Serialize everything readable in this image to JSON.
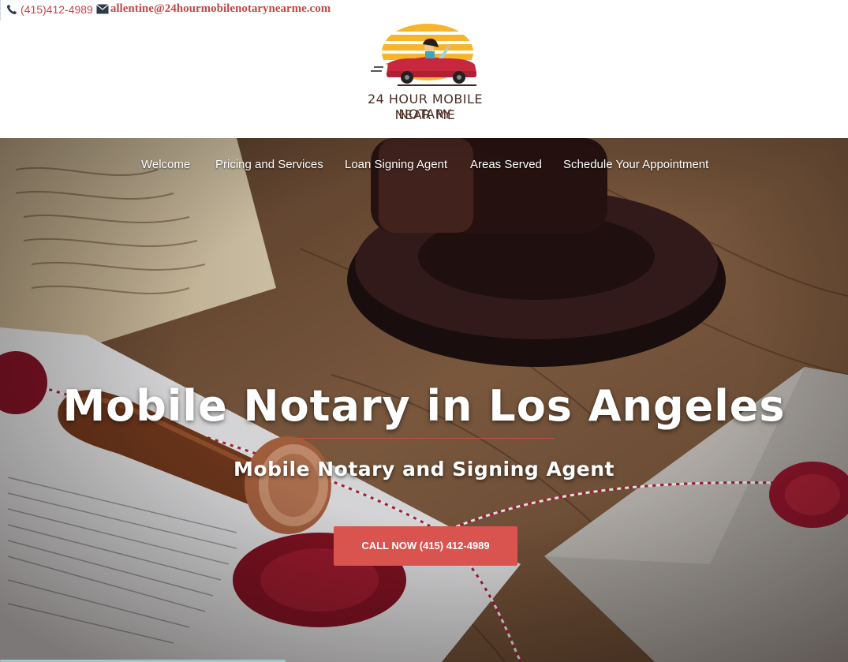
{
  "contact": {
    "phone_icon": "phone-icon",
    "phone": "(415)412-4989",
    "email_icon": "envelope-icon",
    "email": "allentine@24hourmobilenotarynearme.com"
  },
  "logo": {
    "line1": "24 HOUR MOBILE NOTARY",
    "line2": "NEAR ME"
  },
  "nav": {
    "items": [
      {
        "label": "Welcome"
      },
      {
        "label": "Pricing and Services"
      },
      {
        "label": "Loan Signing Agent"
      },
      {
        "label": "Areas Served"
      },
      {
        "label": "Schedule Your Appointment"
      }
    ]
  },
  "hero": {
    "title": "Mobile Notary in Los Angeles",
    "subtitle": "Mobile Notary and Signing Agent",
    "cta_label": "CALL NOW (415) 412-4989"
  },
  "colors": {
    "accent": "#d9534f",
    "contact_text": "#c64848",
    "logo_text": "#4a2d25"
  }
}
